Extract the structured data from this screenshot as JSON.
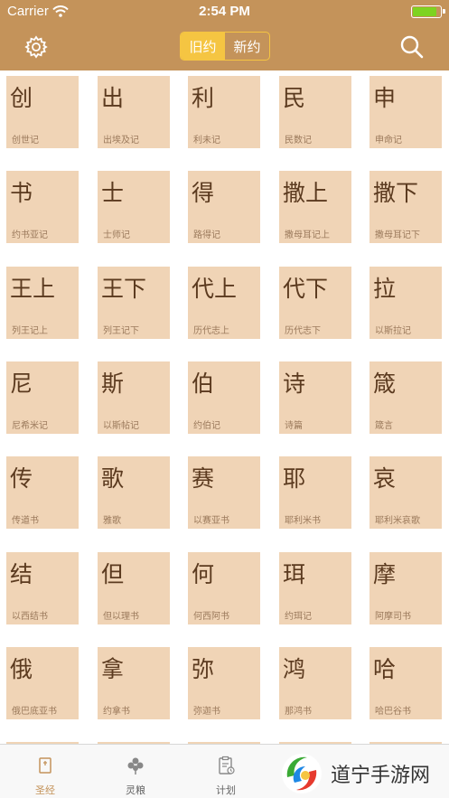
{
  "status_bar": {
    "carrier": "Carrier",
    "time": "2:54 PM",
    "battery_level": 0.85
  },
  "navbar": {
    "settings_icon": "gear-icon",
    "search_icon": "search-icon",
    "segments": [
      {
        "label": "旧约",
        "selected": true
      },
      {
        "label": "新约",
        "selected": false
      }
    ],
    "colors": {
      "bar": "#c4935a",
      "segment_accent": "#f5c542"
    }
  },
  "books": [
    {
      "abbr": "创",
      "name": "创世记"
    },
    {
      "abbr": "出",
      "name": "出埃及记"
    },
    {
      "abbr": "利",
      "name": "利未记"
    },
    {
      "abbr": "民",
      "name": "民数记"
    },
    {
      "abbr": "申",
      "name": "申命记"
    },
    {
      "abbr": "书",
      "name": "约书亚记"
    },
    {
      "abbr": "士",
      "name": "士师记"
    },
    {
      "abbr": "得",
      "name": "路得记"
    },
    {
      "abbr": "撒上",
      "name": "撒母耳记上"
    },
    {
      "abbr": "撒下",
      "name": "撒母耳记下"
    },
    {
      "abbr": "王上",
      "name": "列王记上"
    },
    {
      "abbr": "王下",
      "name": "列王记下"
    },
    {
      "abbr": "代上",
      "name": "历代志上"
    },
    {
      "abbr": "代下",
      "name": "历代志下"
    },
    {
      "abbr": "拉",
      "name": "以斯拉记"
    },
    {
      "abbr": "尼",
      "name": "尼希米记"
    },
    {
      "abbr": "斯",
      "name": "以斯帖记"
    },
    {
      "abbr": "伯",
      "name": "约伯记"
    },
    {
      "abbr": "诗",
      "name": "诗篇"
    },
    {
      "abbr": "箴",
      "name": "箴言"
    },
    {
      "abbr": "传",
      "name": "传道书"
    },
    {
      "abbr": "歌",
      "name": "雅歌"
    },
    {
      "abbr": "赛",
      "name": "以赛亚书"
    },
    {
      "abbr": "耶",
      "name": "耶利米书"
    },
    {
      "abbr": "哀",
      "name": "耶利米哀歌"
    },
    {
      "abbr": "结",
      "name": "以西结书"
    },
    {
      "abbr": "但",
      "name": "但以理书"
    },
    {
      "abbr": "何",
      "name": "何西阿书"
    },
    {
      "abbr": "珥",
      "name": "约珥记"
    },
    {
      "abbr": "摩",
      "name": "阿摩司书"
    },
    {
      "abbr": "俄",
      "name": "俄巴底亚书"
    },
    {
      "abbr": "拿",
      "name": "约拿书"
    },
    {
      "abbr": "弥",
      "name": "弥迦书"
    },
    {
      "abbr": "鸿",
      "name": "那鸿书"
    },
    {
      "abbr": "哈",
      "name": "哈巴谷书"
    }
  ],
  "tabbar": {
    "tabs": [
      {
        "label": "圣经",
        "icon": "book-icon",
        "active": true
      },
      {
        "label": "灵粮",
        "icon": "clover-icon",
        "active": false
      },
      {
        "label": "计划",
        "icon": "clipboard-icon",
        "active": false
      }
    ]
  },
  "watermark": {
    "text": "道宁手游网",
    "icon": "watermark-logo-icon"
  }
}
